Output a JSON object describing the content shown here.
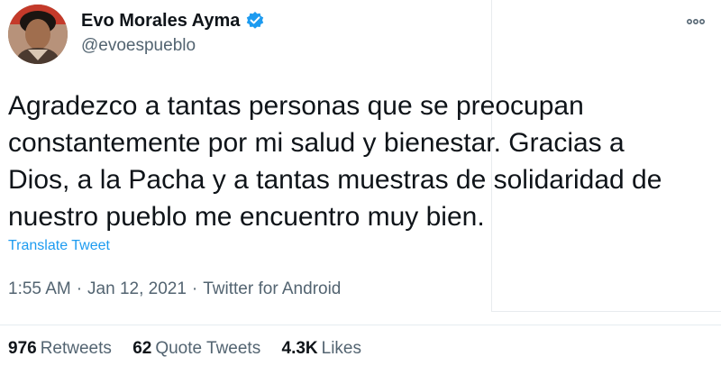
{
  "author": {
    "name": "Evo Morales Ayma",
    "handle": "@evoespueblo",
    "avatar_icon": "profile-photo",
    "verified_icon": "verified-badge-icon",
    "verified_color": "#1d9bf0"
  },
  "more_icon": "ellipsis-icon",
  "tweet": {
    "text": "Agradezco a tantas personas que se preocupan\nconstantemente por mi salud y bienestar. Gracias a\nDios, a la Pacha y a tantas muestras de solidaridad de\nnuestro pueblo me encuentro muy bien.",
    "translate_label": "Translate Tweet",
    "time": "1:55 AM",
    "date": "Jan 12, 2021",
    "source": "Twitter for Android",
    "separator": "·"
  },
  "stats": [
    {
      "count": "976",
      "label": "Retweets"
    },
    {
      "count": "62",
      "label": "Quote Tweets"
    },
    {
      "count": "4.3K",
      "label": "Likes"
    }
  ],
  "colors": {
    "text_primary": "#0f1419",
    "text_secondary": "#536471",
    "link": "#1d9bf0"
  }
}
